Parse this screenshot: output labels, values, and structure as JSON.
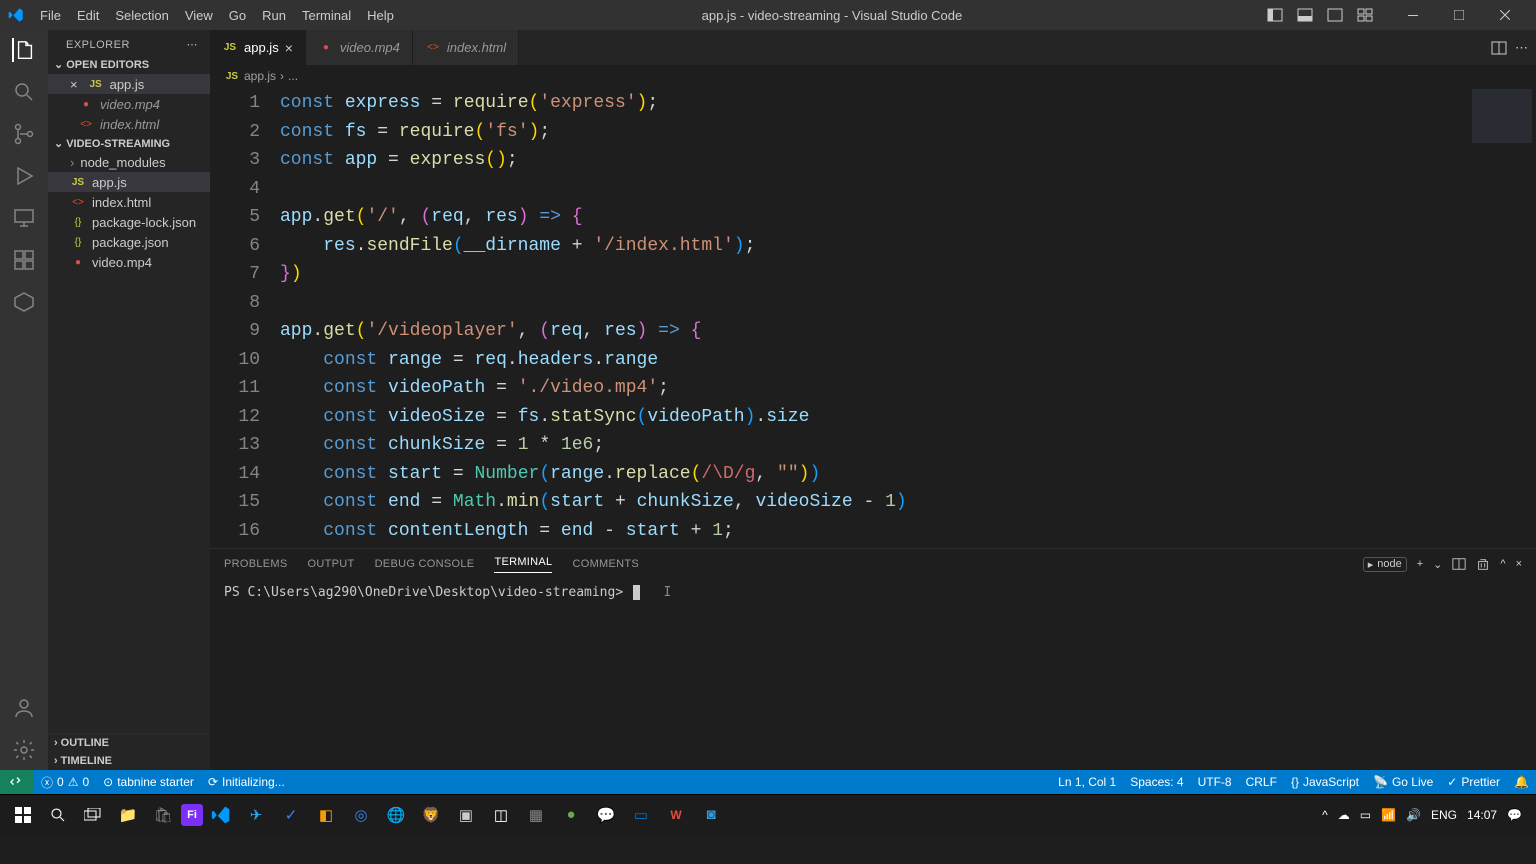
{
  "title": "app.js - video-streaming - Visual Studio Code",
  "menu": [
    "File",
    "Edit",
    "Selection",
    "View",
    "Go",
    "Run",
    "Terminal",
    "Help"
  ],
  "sidebar": {
    "title": "EXPLORER",
    "openEditors": {
      "label": "OPEN EDITORS",
      "items": [
        {
          "name": "app.js",
          "type": "js",
          "close": true
        },
        {
          "name": "video.mp4",
          "type": "vid"
        },
        {
          "name": "index.html",
          "type": "html"
        }
      ]
    },
    "project": {
      "label": "VIDEO-STREAMING",
      "items": [
        {
          "name": "node_modules",
          "type": "folder"
        },
        {
          "name": "app.js",
          "type": "js",
          "active": true
        },
        {
          "name": "index.html",
          "type": "html"
        },
        {
          "name": "package-lock.json",
          "type": "json"
        },
        {
          "name": "package.json",
          "type": "json"
        },
        {
          "name": "video.mp4",
          "type": "vid"
        }
      ]
    },
    "outline": "OUTLINE",
    "timeline": "TIMELINE"
  },
  "tabs": [
    {
      "name": "app.js",
      "type": "js",
      "active": true
    },
    {
      "name": "video.mp4",
      "type": "vid",
      "italic": true
    },
    {
      "name": "index.html",
      "type": "html",
      "italic": true
    }
  ],
  "breadcrumb": {
    "file": "app.js",
    "sep": "›",
    "rest": "..."
  },
  "code": {
    "lines": [
      1,
      2,
      3,
      4,
      5,
      6,
      7,
      8,
      9,
      10,
      11,
      12,
      13,
      14,
      15,
      16
    ]
  },
  "panel": {
    "tabs": [
      "PROBLEMS",
      "OUTPUT",
      "DEBUG CONSOLE",
      "TERMINAL",
      "COMMENTS"
    ],
    "active": "TERMINAL",
    "shell": "node",
    "prompt": "PS C:\\Users\\ag290\\OneDrive\\Desktop\\video-streaming> "
  },
  "status": {
    "errors": "0",
    "warnings": "0",
    "tabnine": "tabnine starter",
    "init": "Initializing...",
    "pos": "Ln 1, Col 1",
    "spaces": "Spaces: 4",
    "enc": "UTF-8",
    "eol": "CRLF",
    "lang": "JavaScript",
    "golive": "Go Live",
    "prettier": "Prettier"
  },
  "taskbar": {
    "lang": "ENG",
    "time": "14:07"
  }
}
